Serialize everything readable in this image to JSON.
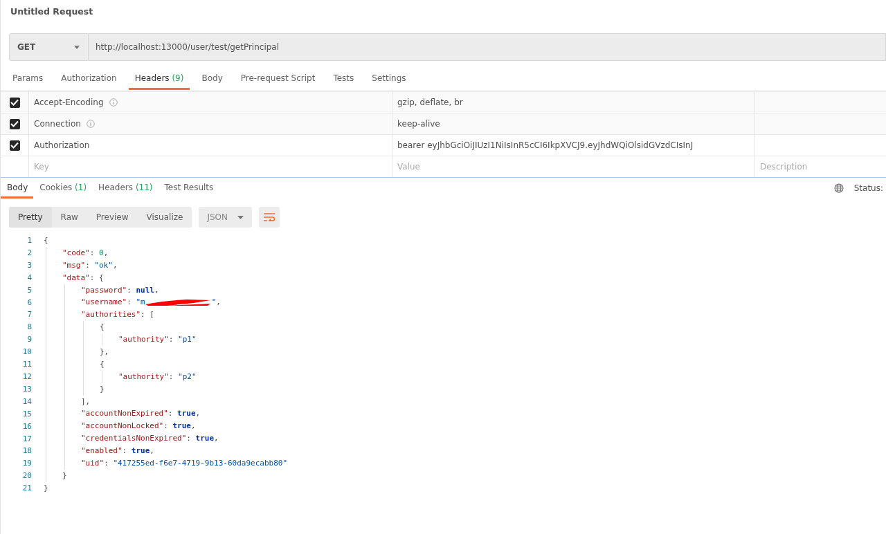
{
  "request_title": "Untitled Request",
  "url_bar": {
    "method": "GET",
    "url": "http://localhost:13000/user/test/getPrincipal"
  },
  "request_tabs": [
    {
      "label": "Params",
      "selected": false
    },
    {
      "label": "Authorization",
      "selected": false
    },
    {
      "label": "Headers",
      "count": "(9)",
      "selected": true
    },
    {
      "label": "Body",
      "selected": false
    },
    {
      "label": "Pre-request Script",
      "selected": false
    },
    {
      "label": "Tests",
      "selected": false
    },
    {
      "label": "Settings",
      "selected": false
    }
  ],
  "headers_table": {
    "rows": [
      {
        "key": "Accept-Encoding",
        "info": true,
        "value": "gzip, deflate, br",
        "checked": true
      },
      {
        "key": "Connection",
        "info": true,
        "value": "keep-alive",
        "checked": true
      },
      {
        "key": "Authorization",
        "info": false,
        "value": "bearer eyJhbGciOiJIUzI1NiIsInR5cCI6IkpXVCJ9.eyJhdWQiOlsidGVzdCIsInJ",
        "checked": true
      }
    ],
    "new_row": [
      {
        "placeholder": "Key"
      },
      {
        "placeholder": "Value"
      },
      {
        "placeholder": "Description"
      }
    ]
  },
  "response_tabs": [
    {
      "label": "Body",
      "selected": true
    },
    {
      "label": "Cookies",
      "count": "(1)",
      "selected": false
    },
    {
      "label": "Headers",
      "count": "(11)",
      "selected": false
    },
    {
      "label": "Test Results",
      "selected": false
    }
  ],
  "status_label": "Status:",
  "view_modes": [
    {
      "label": "Pretty",
      "selected": true
    },
    {
      "label": "Raw",
      "selected": false
    },
    {
      "label": "Preview",
      "selected": false
    },
    {
      "label": "Visualize",
      "selected": false
    }
  ],
  "format_select": "JSON",
  "code": [
    {
      "num": "1",
      "tokens": [
        {
          "kind": "punct",
          "text": "{"
        }
      ],
      "children": [
        {
          "num": "2",
          "tokens": [
            {
              "kind": "key",
              "text": "\"code\""
            },
            {
              "kind": "punct",
              "text": ": "
            },
            {
              "kind": "number",
              "text": "0"
            },
            {
              "kind": "punct",
              "text": ","
            }
          ]
        },
        {
          "num": "3",
          "tokens": [
            {
              "kind": "key",
              "text": "\"msg\""
            },
            {
              "kind": "punct",
              "text": ": "
            },
            {
              "kind": "string",
              "text": "\"ok\""
            },
            {
              "kind": "punct",
              "text": ","
            }
          ]
        },
        {
          "num": "4",
          "tokens": [
            {
              "kind": "key",
              "text": "\"data\""
            },
            {
              "kind": "punct",
              "text": ": {"
            }
          ],
          "children": [
            {
              "num": "5",
              "tokens": [
                {
                  "kind": "key",
                  "text": "\"password\""
                },
                {
                  "kind": "punct",
                  "text": ": "
                },
                {
                  "kind": "literal",
                  "text": "null"
                },
                {
                  "kind": "punct",
                  "text": ","
                }
              ]
            },
            {
              "num": "6",
              "tokens": [
                {
                  "kind": "key",
                  "text": "\"username\""
                },
                {
                  "kind": "punct",
                  "text": ": "
                },
                {
                  "kind": "string",
                  "text": "\"m"
                },
                {
                  "kind": "redaction"
                },
                {
                  "kind": "string",
                  "text": "\""
                },
                {
                  "kind": "punct",
                  "text": ","
                }
              ]
            },
            {
              "num": "7",
              "tokens": [
                {
                  "kind": "key",
                  "text": "\"authorities\""
                },
                {
                  "kind": "punct",
                  "text": ": ["
                }
              ],
              "children": [
                {
                  "num": "8",
                  "tokens": [
                    {
                      "kind": "punct",
                      "text": "{"
                    }
                  ],
                  "children": [
                    {
                      "num": "9",
                      "tokens": [
                        {
                          "kind": "key",
                          "text": "\"authority\""
                        },
                        {
                          "kind": "punct",
                          "text": ": "
                        },
                        {
                          "kind": "string",
                          "text": "\"p1\""
                        }
                      ]
                    }
                  ]
                },
                {
                  "num": "10",
                  "tokens": [
                    {
                      "kind": "punct",
                      "text": "},"
                    }
                  ]
                },
                {
                  "num": "11",
                  "tokens": [
                    {
                      "kind": "punct",
                      "text": "{"
                    }
                  ],
                  "children": [
                    {
                      "num": "12",
                      "tokens": [
                        {
                          "kind": "key",
                          "text": "\"authority\""
                        },
                        {
                          "kind": "punct",
                          "text": ": "
                        },
                        {
                          "kind": "string",
                          "text": "\"p2\""
                        }
                      ]
                    }
                  ]
                },
                {
                  "num": "13",
                  "tokens": [
                    {
                      "kind": "punct",
                      "text": "}"
                    }
                  ]
                }
              ]
            },
            {
              "num": "14",
              "tokens": [
                {
                  "kind": "punct",
                  "text": "],"
                }
              ]
            },
            {
              "num": "15",
              "tokens": [
                {
                  "kind": "key",
                  "text": "\"accountNonExpired\""
                },
                {
                  "kind": "punct",
                  "text": ": "
                },
                {
                  "kind": "literal",
                  "text": "true"
                },
                {
                  "kind": "punct",
                  "text": ","
                }
              ]
            },
            {
              "num": "16",
              "tokens": [
                {
                  "kind": "key",
                  "text": "\"accountNonLocked\""
                },
                {
                  "kind": "punct",
                  "text": ": "
                },
                {
                  "kind": "literal",
                  "text": "true"
                },
                {
                  "kind": "punct",
                  "text": ","
                }
              ]
            },
            {
              "num": "17",
              "tokens": [
                {
                  "kind": "key",
                  "text": "\"credentialsNonExpired\""
                },
                {
                  "kind": "punct",
                  "text": ": "
                },
                {
                  "kind": "literal",
                  "text": "true"
                },
                {
                  "kind": "punct",
                  "text": ","
                }
              ]
            },
            {
              "num": "18",
              "tokens": [
                {
                  "kind": "key",
                  "text": "\"enabled\""
                },
                {
                  "kind": "punct",
                  "text": ": "
                },
                {
                  "kind": "literal",
                  "text": "true"
                },
                {
                  "kind": "punct",
                  "text": ","
                }
              ]
            },
            {
              "num": "19",
              "tokens": [
                {
                  "kind": "key",
                  "text": "\"uid\""
                },
                {
                  "kind": "punct",
                  "text": ": "
                },
                {
                  "kind": "string",
                  "text": "\"417255ed-f6e7-4719-9b13-60da9ecabb80\""
                }
              ]
            }
          ]
        },
        {
          "num": "20",
          "tokens": [
            {
              "kind": "punct",
              "text": "}"
            }
          ]
        }
      ]
    },
    {
      "num": "21",
      "tokens": [
        {
          "kind": "punct",
          "text": "}"
        }
      ]
    }
  ]
}
